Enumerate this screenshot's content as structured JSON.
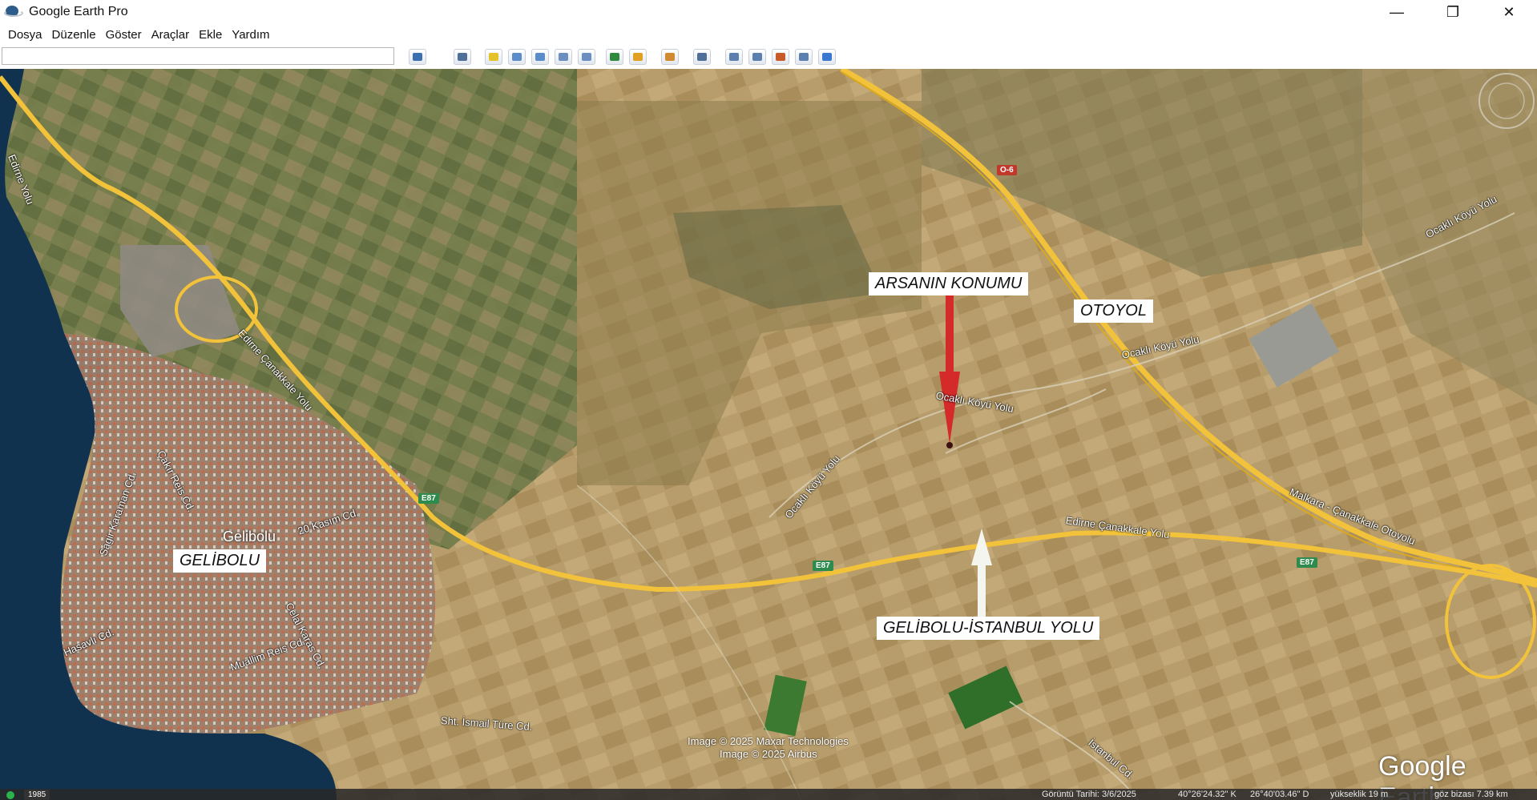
{
  "window": {
    "title": "Google Earth Pro",
    "controls": {
      "minimize": "—",
      "restore": "❐",
      "close": "✕"
    }
  },
  "menu": [
    "Dosya",
    "Düzenle",
    "Göster",
    "Araçlar",
    "Ekle",
    "Yardım"
  ],
  "toolbar": {
    "search_value": "",
    "buttons": [
      {
        "name": "search-icon",
        "color": "#3c6fb0"
      },
      {
        "name": "sidebar-icon",
        "color": "#4d6f9a"
      },
      {
        "name": "placemark-icon",
        "color": "#e3c22a"
      },
      {
        "name": "polygon-icon",
        "color": "#5a8cc9"
      },
      {
        "name": "path-icon",
        "color": "#5a8cc9"
      },
      {
        "name": "overlay-icon",
        "color": "#6a8fc0"
      },
      {
        "name": "tour-icon",
        "color": "#6a8fc0"
      },
      {
        "name": "historical-imagery-icon",
        "color": "#2e8b3e"
      },
      {
        "name": "sunlight-icon",
        "color": "#e0a020"
      },
      {
        "name": "planets-icon",
        "color": "#d08a30"
      },
      {
        "name": "ruler-icon",
        "color": "#4d6f9a"
      },
      {
        "name": "email-icon",
        "color": "#5b7fae"
      },
      {
        "name": "print-icon",
        "color": "#5b7fae"
      },
      {
        "name": "save-image-icon",
        "color": "#c85a2a"
      },
      {
        "name": "movie-maker-icon",
        "color": "#5b7fae"
      },
      {
        "name": "google-maps-icon",
        "color": "#3a78d0"
      }
    ]
  },
  "map": {
    "labels": {
      "arsa": "ARSANIN KONUMU",
      "otoyol": "OTOYOL",
      "gelibolu": "GELİBOLU",
      "yol": "GELİBOLU-İSTANBUL YOLU"
    },
    "place": "Gelibolu",
    "roads": {
      "edirne1": "Edirne Çanakkale Yolu",
      "edirne2": "Edirne Çanakkale Yolu",
      "malkara": "Malkara - Çanakkale Otoyolu",
      "ocakli1": "Ocaklı Köyü Yolu",
      "ocakli2": "Ocaklı Köyü Yolu",
      "ocakli3": "Ocaklı Köyü Yolu",
      "ocakli4": "Ocaklı Köyü Yolu",
      "kasim": "20 Kasım Cd.",
      "ismail": "Sht. İsmail Türe Cd.",
      "istanbul": "İstanbul Cd.",
      "hasavli": "Hasavlı Cd.",
      "muallim": "Muallim Reis Cd.",
      "cakir": "Çakır Reis Cd.",
      "karaman": "Sagir Karaman Cd.",
      "gelal": "Celal Karas Cd.",
      "edirne_n": "Edirne Yolu"
    },
    "shields": {
      "e87a": "E87",
      "e87b": "E87",
      "e87c": "E87",
      "o6": "O-6"
    },
    "attribution1": "Image © 2025 Maxar Technologies",
    "attribution2": "Image © 2025 Airbus",
    "brand": "Google Earth",
    "colors": {
      "highway": "#f2c23a",
      "arrow_red": "#d42a2a",
      "arrow_white": "#f5f5f0",
      "sea": "#0f2a44"
    }
  },
  "status": {
    "year": "1985",
    "date": "Görüntü Tarihi: 3/6/2025",
    "lat": "40°26'24.32\" K",
    "lon": "26°40'03.46\" D",
    "elev": "yükseklik   19 m",
    "eye": "göz bizası   7.39 km"
  }
}
